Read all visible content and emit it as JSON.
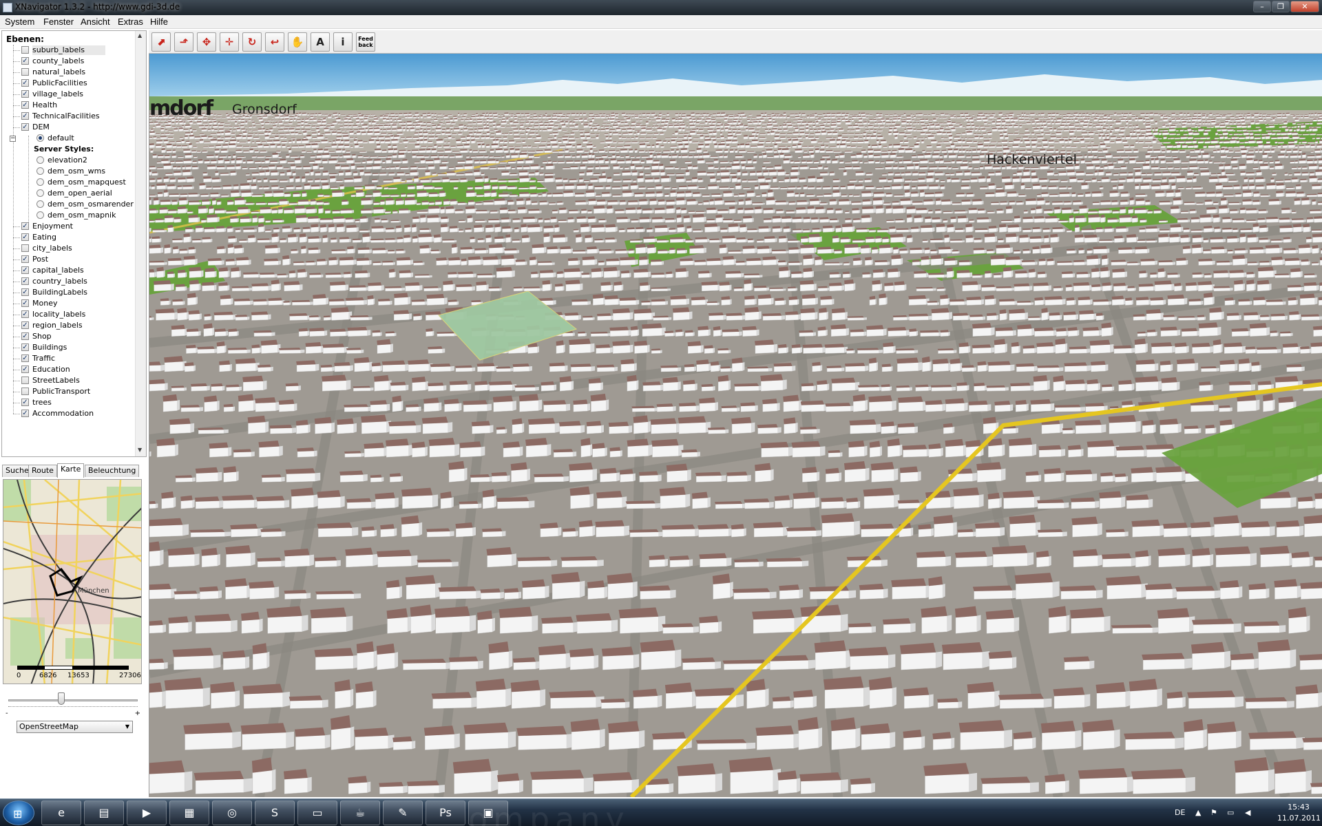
{
  "window": {
    "title": "XNavigator 1.3.2 - http://www.gdi-3d.de",
    "min_glyph": "–",
    "max_glyph": "❐",
    "close_glyph": "✕"
  },
  "menu": [
    "System",
    "Fenster",
    "Ansicht",
    "Extras",
    "Hilfe"
  ],
  "layers": {
    "heading": "Ebenen:",
    "items_top": [
      {
        "label": "suburb_labels",
        "checked": false
      },
      {
        "label": "county_labels",
        "checked": true
      },
      {
        "label": "natural_labels",
        "checked": false
      },
      {
        "label": "PublicFacilities",
        "checked": true
      },
      {
        "label": "village_labels",
        "checked": true
      },
      {
        "label": "Health",
        "checked": true
      },
      {
        "label": "TechnicalFacilities",
        "checked": true
      },
      {
        "label": "DEM",
        "checked": true
      }
    ],
    "dem_default": "default",
    "server_styles_label": "Server Styles:",
    "server_styles": [
      "elevation2",
      "dem_osm_wms",
      "dem_osm_mapquest",
      "dem_open_aerial",
      "dem_osm_osmarender",
      "dem_osm_mapnik"
    ],
    "items_bottom": [
      {
        "label": "Enjoyment",
        "checked": true
      },
      {
        "label": "Eating",
        "checked": true
      },
      {
        "label": "city_labels",
        "checked": false
      },
      {
        "label": "Post",
        "checked": true
      },
      {
        "label": "capital_labels",
        "checked": true
      },
      {
        "label": "country_labels",
        "checked": true
      },
      {
        "label": "BuildingLabels",
        "checked": true
      },
      {
        "label": "Money",
        "checked": true
      },
      {
        "label": "locality_labels",
        "checked": true
      },
      {
        "label": "region_labels",
        "checked": true
      },
      {
        "label": "Shop",
        "checked": true
      },
      {
        "label": "Buildings",
        "checked": true
      },
      {
        "label": "Traffic",
        "checked": true
      },
      {
        "label": "Education",
        "checked": true
      },
      {
        "label": "StreetLabels",
        "checked": false
      },
      {
        "label": "PublicTransport",
        "checked": false
      },
      {
        "label": "trees",
        "checked": true
      },
      {
        "label": "Accommodation",
        "checked": true
      }
    ]
  },
  "tabs": [
    "Suche",
    "Route",
    "Karte",
    "Beleuchtung"
  ],
  "active_tab": "Karte",
  "minimap": {
    "city_label": "München",
    "scale_labels": [
      "0",
      "6826",
      "13653",
      "27306"
    ]
  },
  "zoom": {
    "minus": "-",
    "plus": "+",
    "level": 0.4
  },
  "map_source": {
    "selected": "OpenStreetMap"
  },
  "toolbar": {
    "tools": [
      {
        "name": "zoom-in-tool",
        "glyph": "⬈",
        "style": "red"
      },
      {
        "name": "tilt-tool",
        "glyph": "⬏",
        "style": "red"
      },
      {
        "name": "pan-tool",
        "glyph": "✥",
        "style": "red"
      },
      {
        "name": "move-tool",
        "glyph": "✛",
        "style": "red"
      },
      {
        "name": "rotate-tool",
        "glyph": "↻",
        "style": "red"
      },
      {
        "name": "return-tool",
        "glyph": "↩",
        "style": "red"
      },
      {
        "name": "hand-tool",
        "glyph": "✋",
        "style": "dark"
      },
      {
        "name": "annotation-tool",
        "glyph": "A",
        "style": "dark"
      },
      {
        "name": "info-tool",
        "glyph": "i",
        "style": "dark"
      },
      {
        "name": "feedback-tool",
        "glyph": "Feed back",
        "style": "feedback"
      }
    ]
  },
  "view3d": {
    "labels": {
      "west": "mdorf",
      "gronsdorf": "Gronsdorf",
      "hacken": "Hackenviertel"
    }
  },
  "colors": {
    "sky": "#6fb3dd",
    "park": "#6aa23f",
    "roof": "#8c6a63",
    "wall": "#f4f4f4",
    "street": "#9e9b96",
    "plaza": "#9fc7a1",
    "highway": "#e5c620"
  },
  "taskbar": {
    "watermark": "ompany",
    "start_glyph": "⊞",
    "apps": [
      {
        "name": "ie-icon",
        "glyph": "e"
      },
      {
        "name": "explorer-icon",
        "glyph": "▤"
      },
      {
        "name": "media-player-icon",
        "glyph": "▶"
      },
      {
        "name": "notepad-icon",
        "glyph": "▦"
      },
      {
        "name": "app-g-icon",
        "glyph": "◎"
      },
      {
        "name": "skype-icon",
        "glyph": "S"
      },
      {
        "name": "terminal-icon",
        "glyph": "▭"
      },
      {
        "name": "java-icon",
        "glyph": "☕"
      },
      {
        "name": "paint-icon",
        "glyph": "✎"
      },
      {
        "name": "photoshop-icon",
        "glyph": "Ps"
      },
      {
        "name": "image-viewer-icon",
        "glyph": "▣"
      }
    ],
    "tray": {
      "lang": "DE",
      "time": "15:43",
      "date": "11.07.2011"
    }
  }
}
